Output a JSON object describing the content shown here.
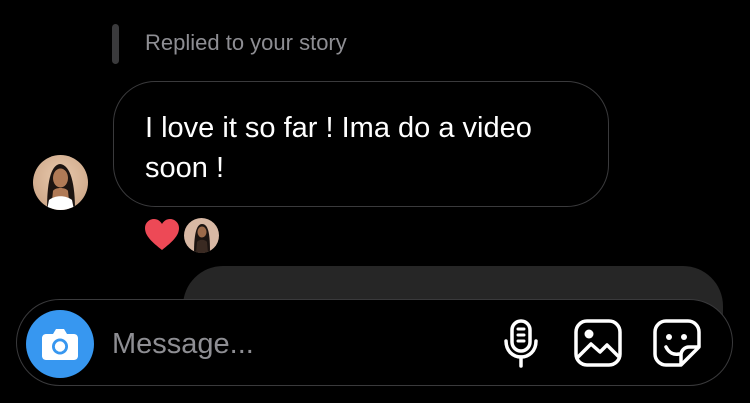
{
  "reply": {
    "label": "Replied to your story"
  },
  "message": {
    "line1": "I love it so far ! Ima do a video",
    "line2": "soon !"
  },
  "reactions": {
    "icons": [
      "heart-reaction-icon",
      "reactor-avatar"
    ],
    "heart_color": "#ed4956"
  },
  "composer": {
    "placeholder": "Message...",
    "camera_icon": "camera-icon",
    "accent": "#3797f0",
    "tools": [
      "microphone-icon",
      "gallery-icon",
      "sticker-icon"
    ]
  }
}
